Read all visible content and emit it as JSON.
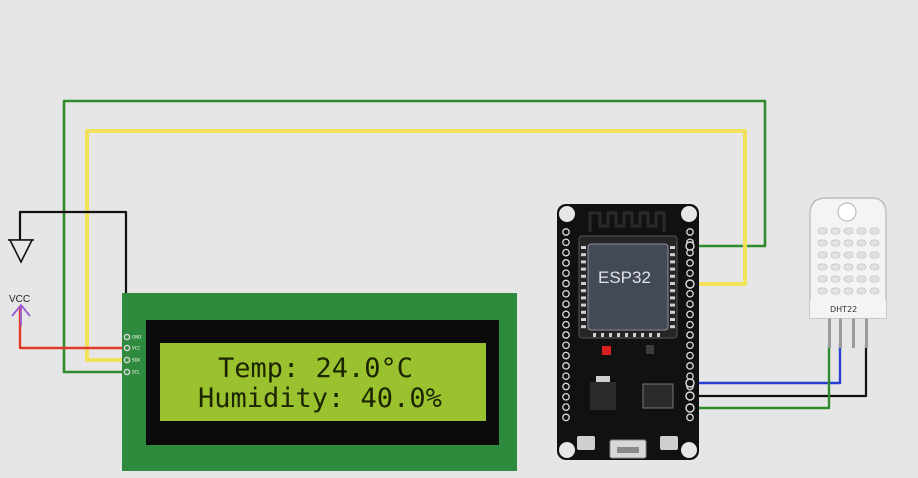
{
  "power": {
    "vcc_label": "VCC"
  },
  "lcd": {
    "pins": [
      "GND",
      "VCC",
      "SDA",
      "SCL"
    ],
    "line1": "Temp: 24.0°C",
    "line2": "Humidity: 40.0%"
  },
  "esp32": {
    "label": "ESP32"
  },
  "dht22": {
    "label": "DHT22"
  },
  "colors": {
    "background": "#e6e6e6",
    "wire_green": "#2e8b2e",
    "wire_yellow": "#f2e25a",
    "wire_red": "#e03a2a",
    "wire_blue": "#2a3fd0",
    "wire_black": "#111111",
    "vcc_arrow": "#9b59d0",
    "lcd_pcb": "#2e8a3c",
    "lcd_screen": "#9ac22e",
    "esp32_board": "#111111"
  }
}
